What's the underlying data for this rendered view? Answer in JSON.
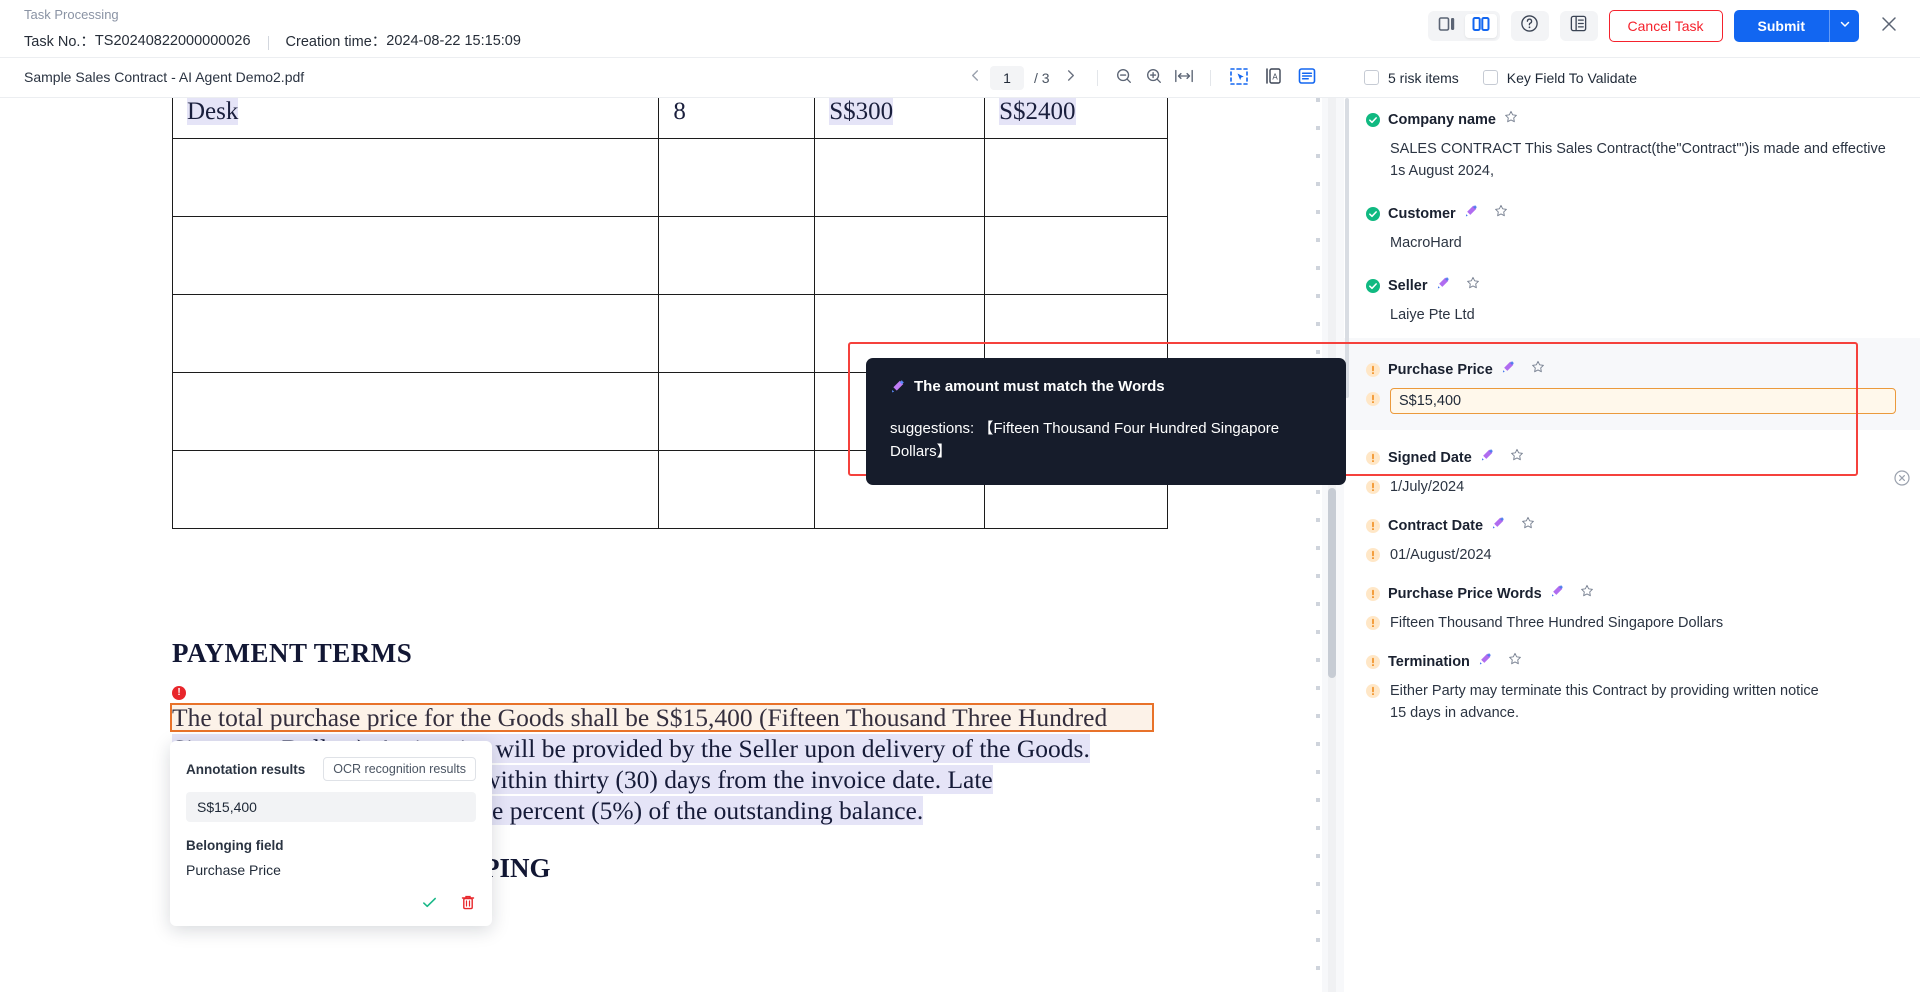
{
  "header": {
    "breadcrumb": "Task Processing",
    "task_no_label": "Task No.：",
    "task_no_value": "TS20240822000000026",
    "creation_time_label": "Creation time：",
    "creation_time_value": "2024-08-22 15:15:09",
    "cancel_label": "Cancel Task",
    "submit_label": "Submit",
    "icons": {
      "layout_single": "layout-single-icon",
      "layout_split": "layout-split-icon",
      "help": "help-circle-icon",
      "grid": "grid-panel-icon",
      "close": "close-icon",
      "caret": "chevron-down-icon"
    },
    "accent": "#1266f1",
    "danger": "#f5222d"
  },
  "subbar": {
    "filename": "Sample Sales Contract - AI Agent Demo2.pdf",
    "page_current": "1",
    "page_total": "/ 3",
    "tools": {
      "prev": "chevron-left-icon",
      "next": "chevron-right-icon",
      "zoom_out": "zoom-out-icon",
      "zoom_in": "zoom-in-icon",
      "fit_width": "fit-width-icon",
      "select_region": "select-region-icon",
      "text_recognize": "text-recognize-icon",
      "panel_toggle": "panel-toggle-icon"
    }
  },
  "right_panel": {
    "risk_checkbox_label": "5 risk items",
    "key_field_checkbox_label": "Key Field To Validate",
    "fields": [
      {
        "name": "Company name",
        "status": "ok",
        "has_ai_icon": false,
        "value": "SALES CONTRACT This Sales Contract(the\"Contract'\")is made and effective 1s August 2024,",
        "value_status": "none"
      },
      {
        "name": "Customer",
        "status": "ok",
        "has_ai_icon": true,
        "value": "MacroHard",
        "value_status": "none"
      },
      {
        "name": "Seller",
        "status": "ok",
        "has_ai_icon": true,
        "value": "Laiye Pte Ltd",
        "value_status": "none"
      },
      {
        "name": "Purchase Price",
        "status": "warn",
        "has_ai_icon": true,
        "value": "S$15,400",
        "value_status": "warn",
        "editing": true,
        "highlighted": true
      },
      {
        "name": "Signed Date",
        "status": "warn",
        "has_ai_icon": true,
        "value": "1/July/2024",
        "value_status": "warn"
      },
      {
        "name": "Contract Date",
        "status": "warn",
        "has_ai_icon": true,
        "value": "01/August/2024",
        "value_status": "warn"
      },
      {
        "name": "Purchase Price Words",
        "status": "warn",
        "has_ai_icon": true,
        "value": "Fifteen Thousand Three Hundred Singapore Dollars",
        "value_status": "warn"
      },
      {
        "name": "Termination",
        "status": "warn",
        "has_ai_icon": true,
        "value": "Either Party may terminate this Contract by providing written notice 15 days in advance.",
        "value_status": "warn"
      }
    ],
    "star_icon": "star-outline-icon",
    "ai_icon": "ai-magic-icon",
    "collapse_icon": "collapse-panel-icon",
    "ok_color": "#10b981",
    "warn_color": "#f8a33c",
    "highlight_border": "#f5413c"
  },
  "tooltip": {
    "icon": "ai-magic-icon",
    "title": "The amount must match the Words",
    "body": "suggestions:  【Fifteen Thousand Four Hundred Singapore Dollars】"
  },
  "annotation_popup": {
    "title": "Annotation results",
    "tag": "OCR recognition results",
    "value": "S$15,400",
    "belonging_label": "Belonging field",
    "belonging_value": "Purchase Price",
    "confirm_icon": "check-icon",
    "delete_icon": "trash-icon"
  },
  "document": {
    "table": {
      "rows": [
        [
          "Desk",
          "8",
          "S$300",
          "S$2400"
        ],
        [
          "",
          "",
          "",
          ""
        ],
        [
          "",
          "",
          "",
          ""
        ],
        [
          "",
          "",
          "",
          ""
        ],
        [
          "",
          "",
          "",
          ""
        ],
        [
          "",
          "",
          "",
          ""
        ]
      ]
    },
    "section_title": "PAYMENT TERMS",
    "paragraph_lines": [
      "The total purchase price for the Goods shall be S$15,400 (Fifteen Thousand Three  Hundred",
      "Singapore Dollars). An invoice will be provided by the Seller upon delivery of the Goods.",
      "Payment shall be made in full within thirty (30) days from the invoice date. Late",
      "payments will incur a fee of five percent (5%) of the outstanding balance."
    ],
    "next_heading": "SHIPPING"
  }
}
